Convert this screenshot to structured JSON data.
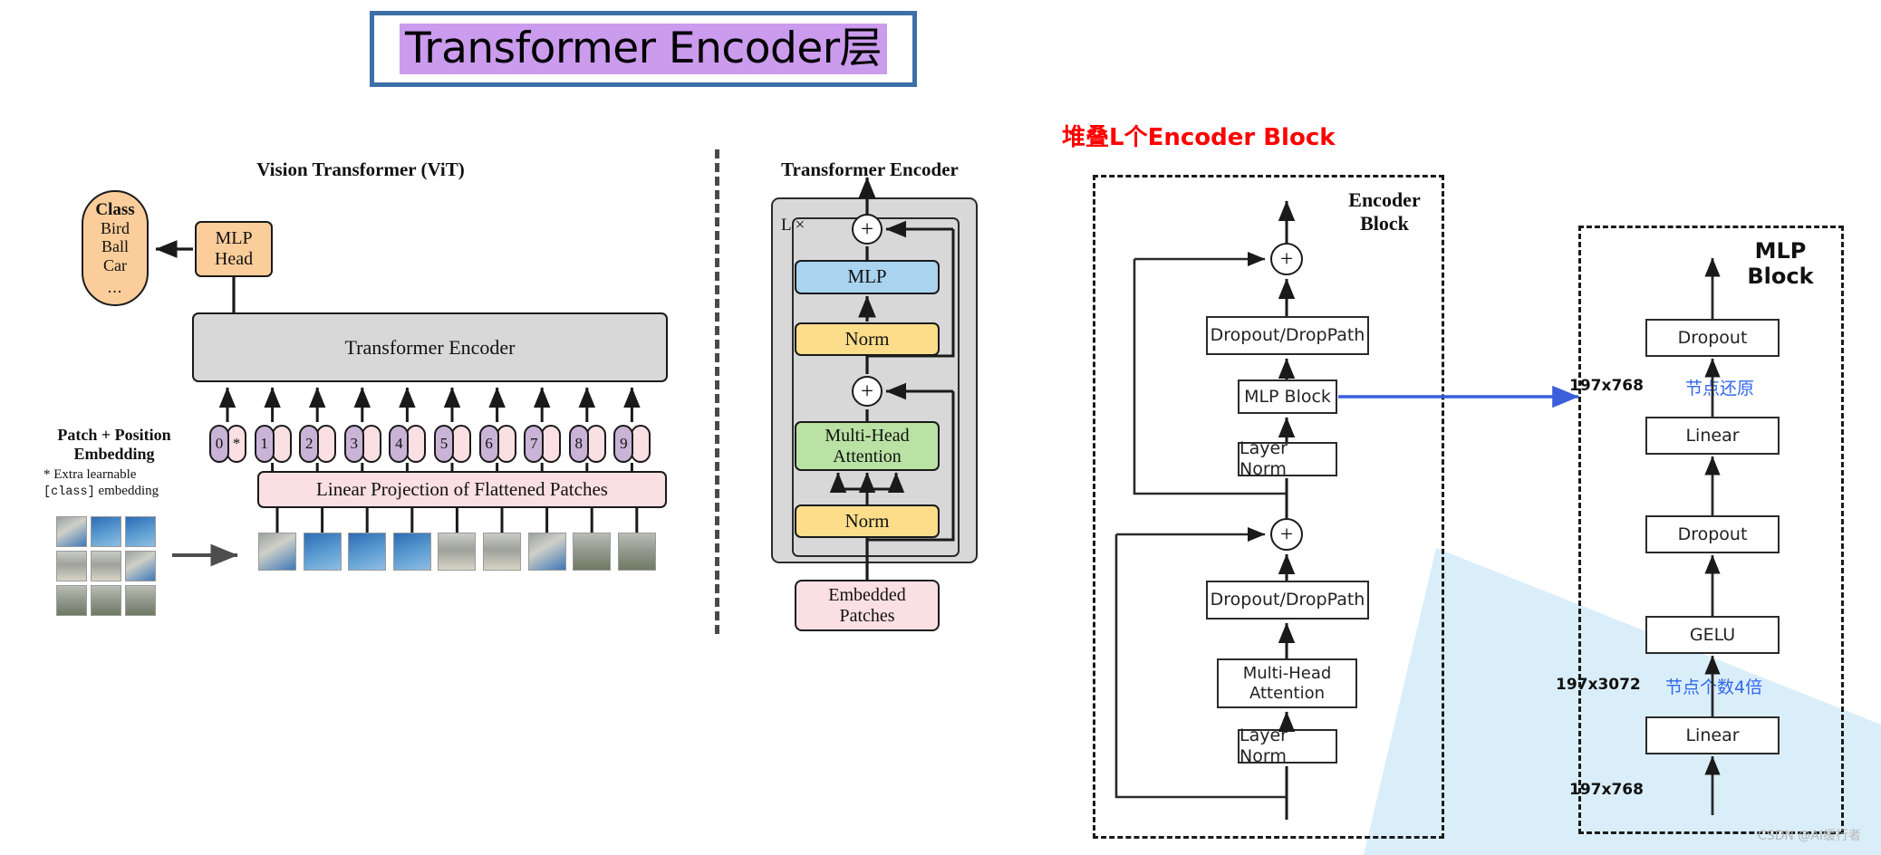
{
  "title": {
    "text": "Transformer Encoder层",
    "highlight_color": "#cb9bee",
    "border_color": "#3d6fa8"
  },
  "vit": {
    "title": "Vision Transformer (ViT)",
    "class_head": "Class",
    "class_items": [
      "Bird",
      "Ball",
      "Car"
    ],
    "class_ellipsis": "...",
    "mlp_head_line1": "MLP",
    "mlp_head_line2": "Head",
    "encoder_bar": "Transformer Encoder",
    "patch_pos_line1": "Patch + Position",
    "patch_pos_line2": "Embedding",
    "note_line1": "* Extra learnable",
    "note_mono": "[class]",
    "note_line2_tail": " embedding",
    "linear_projection": "Linear Projection of Flattened Patches",
    "tokens": [
      "0",
      "1",
      "2",
      "3",
      "4",
      "5",
      "6",
      "7",
      "8",
      "9"
    ],
    "extra_token_marker": "*"
  },
  "transformer_encoder": {
    "title": "Transformer Encoder",
    "repeat_label": "L ×",
    "mlp": "MLP",
    "norm_top": "Norm",
    "mha_line1": "Multi-Head",
    "mha_line2": "Attention",
    "norm_bottom": "Norm",
    "embedded_line1": "Embedded",
    "embedded_line2": "Patches",
    "plus_symbol": "+",
    "colors": {
      "mlp": "#a9d3ef",
      "norm": "#fbdd8a",
      "attention": "#b9e2a4",
      "embedded": "#fadfe3",
      "panel": "#d8d8d8"
    }
  },
  "right_section": {
    "heading": "堆叠L个Encoder Block",
    "heading_color": "#ff0000"
  },
  "encoder_block": {
    "label_line1": "Encoder",
    "label_line2": "Block",
    "dropout_top": "Dropout/DropPath",
    "mlp_block": "MLP Block",
    "layer_norm_top": "Layer Norm",
    "dropout_bottom": "Dropout/DropPath",
    "mha_line1": "Multi-Head",
    "mha_line2": "Attention",
    "layer_norm_bottom": "Layer Norm",
    "plus_symbol": "+"
  },
  "mlp_block": {
    "label_line1": "MLP",
    "label_line2": "Block",
    "dropout_top": "Dropout",
    "linear_top": "Linear",
    "dropout_mid": "Dropout",
    "gelu": "GELU",
    "linear_bottom": "Linear",
    "dim_top": "197x768",
    "dim_mid": "197x3072",
    "dim_bottom": "197x768",
    "note_restore": "节点还原",
    "note_4x": "节点个数4倍",
    "note_color": "#3366ee"
  },
  "watermark": "CSDN @AI缓行者"
}
